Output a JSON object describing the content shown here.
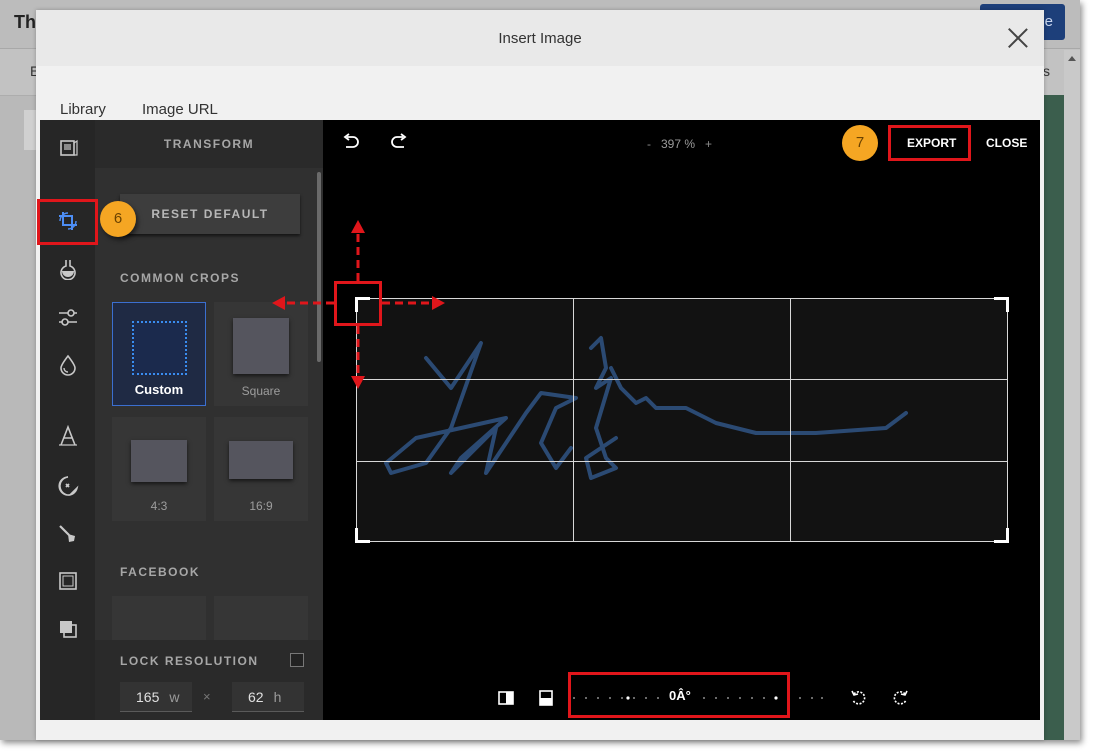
{
  "background": {
    "app_title": "Th",
    "primary_button_label": "e",
    "subbar_left": "E",
    "subbar_right": "s"
  },
  "modal": {
    "title": "Insert Image",
    "tabs": [
      {
        "label": "Library"
      },
      {
        "label": "Image URL"
      }
    ]
  },
  "editor": {
    "panel": {
      "title": "TRANSFORM",
      "reset_label": "RESET DEFAULT",
      "common_crops_label": "COMMON CROPS",
      "crops": [
        {
          "label": "Custom",
          "active": true
        },
        {
          "label": "Square"
        },
        {
          "label": "4:3"
        },
        {
          "label": "16:9"
        }
      ],
      "facebook_label": "FACEBOOK",
      "lock_label": "LOCK RESOLUTION",
      "lock_checked": false,
      "width_value": "165",
      "width_unit": "w",
      "times_symbol": "×",
      "height_value": "62",
      "height_unit": "h"
    },
    "toolbar": {
      "zoom_minus": "-",
      "zoom_value": "397 %",
      "zoom_plus": "+",
      "export_label": "EXPORT",
      "close_label": "CLOSE"
    },
    "bottom": {
      "rotation_angle": "0Â°"
    },
    "rail_icons": [
      "picture-frame-icon",
      "crop-rotate-icon",
      "filter-flask-icon",
      "adjust-sliders-icon",
      "drop-icon",
      "text-icon",
      "sticker-icon",
      "brush-icon",
      "frame-icon",
      "overlay-icon"
    ]
  },
  "callouts": {
    "step6": "6",
    "step7": "7"
  },
  "colors": {
    "highlight_red": "#e0161b",
    "callout_orange": "#f5a623",
    "accent_blue": "#3b6fd0",
    "signature_blue": "#2b4a73"
  }
}
